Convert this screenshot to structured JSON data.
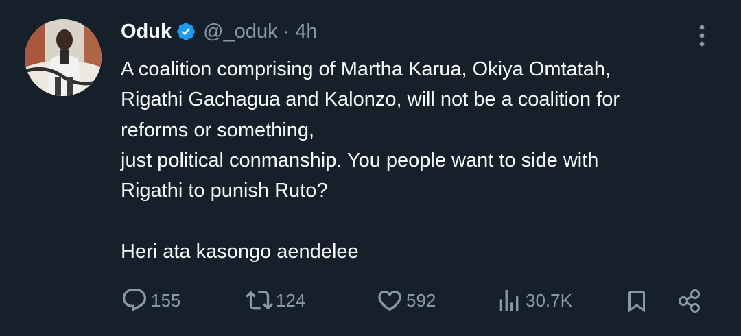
{
  "tweet": {
    "display_name": "Oduk",
    "handle": "@_oduk",
    "separator": "·",
    "time": "4h",
    "lines": [
      "A coalition comprising of Martha Karua, Okiya Omtatah,",
      "Rigathi Gachagua and Kalonzo, will not be a coalition for",
      "reforms or something,",
      "just political conmanship. You people want to side with",
      "Rigathi to punish Ruto?",
      "",
      "Heri ata kasongo aendelee"
    ]
  },
  "actions": {
    "replies": "155",
    "retweets": "124",
    "likes": "592",
    "views": "30.7K"
  },
  "icons": {
    "verified": "verified-badge-icon",
    "more": "more-vertical-icon",
    "reply": "reply-icon",
    "retweet": "retweet-icon",
    "like": "heart-icon",
    "views": "views-chart-icon",
    "bookmark": "bookmark-icon",
    "share": "share-icon"
  },
  "colors": {
    "background": "#15202b",
    "text": "#f7f9f9",
    "muted": "#8b98a5",
    "verified": "#1d9bf0"
  }
}
